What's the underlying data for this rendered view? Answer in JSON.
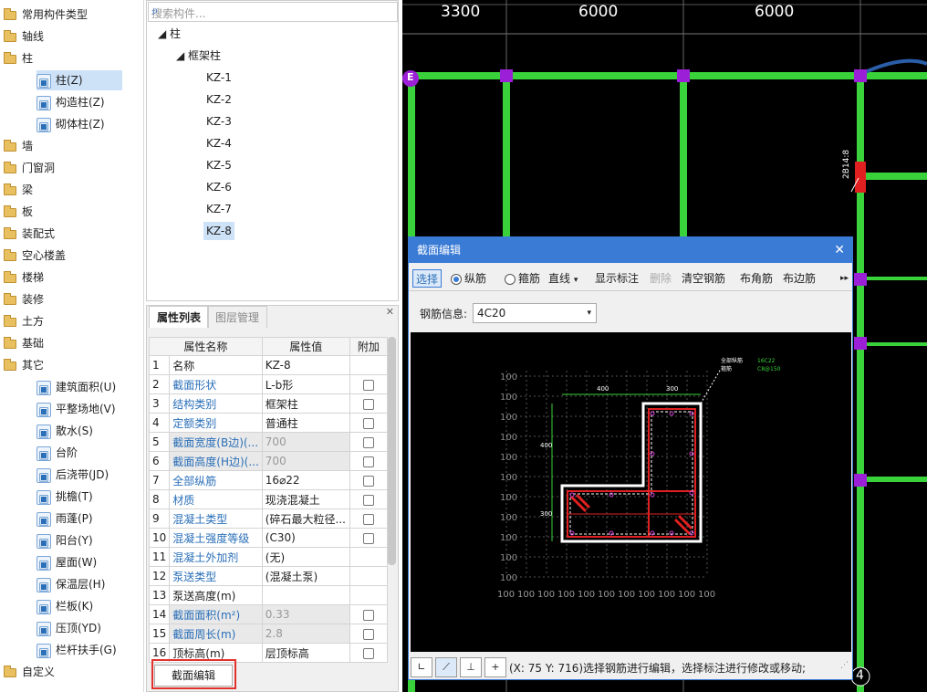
{
  "tree": {
    "items": [
      {
        "label": "常用构件类型",
        "level": 0,
        "icon": "folder-icon"
      },
      {
        "label": "轴线",
        "level": 0,
        "icon": "folder-icon"
      },
      {
        "label": "柱",
        "level": 0,
        "icon": "open-folder-icon"
      },
      {
        "label": "柱(Z)",
        "level": 1,
        "icon": "column-icon",
        "selected": true
      },
      {
        "label": "构造柱(Z)",
        "level": 1,
        "icon": "constructional-column-icon"
      },
      {
        "label": "砌体柱(Z)",
        "level": 1,
        "icon": "masonry-column-icon"
      },
      {
        "label": "墙",
        "level": 0,
        "icon": "folder-icon"
      },
      {
        "label": "门窗洞",
        "level": 0,
        "icon": "folder-icon"
      },
      {
        "label": "梁",
        "level": 0,
        "icon": "folder-icon"
      },
      {
        "label": "板",
        "level": 0,
        "icon": "folder-icon"
      },
      {
        "label": "装配式",
        "level": 0,
        "icon": "folder-icon"
      },
      {
        "label": "空心楼盖",
        "level": 0,
        "icon": "folder-icon"
      },
      {
        "label": "楼梯",
        "level": 0,
        "icon": "folder-icon"
      },
      {
        "label": "装修",
        "level": 0,
        "icon": "folder-icon"
      },
      {
        "label": "土方",
        "level": 0,
        "icon": "folder-icon"
      },
      {
        "label": "基础",
        "level": 0,
        "icon": "folder-icon"
      },
      {
        "label": "其它",
        "level": 0,
        "icon": "open-folder-icon"
      },
      {
        "label": "建筑面积(U)",
        "level": 1,
        "icon": "building-area-icon"
      },
      {
        "label": "平整场地(V)",
        "level": 1,
        "icon": "site-leveling-icon"
      },
      {
        "label": "散水(S)",
        "level": 1,
        "icon": "apron-icon"
      },
      {
        "label": "台阶",
        "level": 1,
        "icon": "steps-icon"
      },
      {
        "label": "后浇带(JD)",
        "level": 1,
        "icon": "post-pour-strip-icon"
      },
      {
        "label": "挑檐(T)",
        "level": 1,
        "icon": "cornice-icon"
      },
      {
        "label": "雨蓬(P)",
        "level": 1,
        "icon": "canopy-icon"
      },
      {
        "label": "阳台(Y)",
        "level": 1,
        "icon": "balcony-icon"
      },
      {
        "label": "屋面(W)",
        "level": 1,
        "icon": "roof-icon"
      },
      {
        "label": "保温层(H)",
        "level": 1,
        "icon": "insulation-icon"
      },
      {
        "label": "栏板(K)",
        "level": 1,
        "icon": "parapet-icon"
      },
      {
        "label": "压顶(YD)",
        "level": 1,
        "icon": "coping-icon"
      },
      {
        "label": "栏杆扶手(G)",
        "level": 1,
        "icon": "railing-icon"
      },
      {
        "label": "自定义",
        "level": 0,
        "icon": "folder-icon"
      }
    ]
  },
  "components": {
    "search_placeholder": "搜索构件...",
    "root": "柱",
    "group": "框架柱",
    "items": [
      "KZ-1",
      "KZ-2",
      "KZ-3",
      "KZ-4",
      "KZ-5",
      "KZ-6",
      "KZ-7",
      "KZ-8"
    ],
    "selected": "KZ-8"
  },
  "props": {
    "tab_attr": "属性列表",
    "tab_layer": "图层管理",
    "headers": [
      "属性名称",
      "属性值",
      "附加"
    ],
    "rows": [
      {
        "n": "1",
        "name": "名称",
        "value": "KZ-8",
        "blue": false,
        "gray": false,
        "cb": false
      },
      {
        "n": "2",
        "name": "截面形状",
        "value": "L-b形",
        "blue": true,
        "gray": false,
        "cb": true
      },
      {
        "n": "3",
        "name": "结构类别",
        "value": "框架柱",
        "blue": true,
        "gray": false,
        "cb": true
      },
      {
        "n": "4",
        "name": "定额类别",
        "value": "普通柱",
        "blue": true,
        "gray": false,
        "cb": true
      },
      {
        "n": "5",
        "name": "截面宽度(B边)(...",
        "value": "700",
        "blue": true,
        "gray": true,
        "cb": true
      },
      {
        "n": "6",
        "name": "截面高度(H边)(...",
        "value": "700",
        "blue": true,
        "gray": true,
        "cb": true
      },
      {
        "n": "7",
        "name": "全部纵筋",
        "value": "16⌀22",
        "blue": true,
        "gray": false,
        "cb": true
      },
      {
        "n": "8",
        "name": "材质",
        "value": "现浇混凝土",
        "blue": true,
        "gray": false,
        "cb": true
      },
      {
        "n": "9",
        "name": "混凝土类型",
        "value": "(碎石最大粒径...",
        "blue": true,
        "gray": false,
        "cb": true
      },
      {
        "n": "10",
        "name": "混凝土强度等级",
        "value": "(C30)",
        "blue": true,
        "gray": false,
        "cb": true
      },
      {
        "n": "11",
        "name": "混凝土外加剂",
        "value": "(无)",
        "blue": true,
        "gray": false,
        "cb": false
      },
      {
        "n": "12",
        "name": "泵送类型",
        "value": "(混凝土泵)",
        "blue": true,
        "gray": false,
        "cb": false
      },
      {
        "n": "13",
        "name": "泵送高度(m)",
        "value": "",
        "blue": false,
        "gray": false,
        "cb": false
      },
      {
        "n": "14",
        "name": "截面面积(m²)",
        "value": "0.33",
        "blue": true,
        "gray": true,
        "cb": true
      },
      {
        "n": "15",
        "name": "截面周长(m)",
        "value": "2.8",
        "blue": true,
        "gray": true,
        "cb": true
      },
      {
        "n": "16",
        "name": "顶标高(m)",
        "value": "层顶标高",
        "blue": false,
        "gray": false,
        "cb": true
      }
    ],
    "section_edit_button": "截面编辑"
  },
  "cad": {
    "dims": [
      "3300",
      "6000",
      "6000"
    ],
    "axis_e": "E",
    "axis_4": "4",
    "beam_label": "2B14:8"
  },
  "dialog": {
    "title": "截面编辑",
    "toolbar": {
      "select": "选择",
      "longitudinal": "纵筋",
      "stirrup": "箍筋",
      "line_mode": "直线",
      "show_dim": "显示标注",
      "delete": "删除",
      "clear": "清空钢筋",
      "corner": "布角筋",
      "edge": "布边筋"
    },
    "rebar_info_label": "钢筋信息:",
    "rebar_info_value": "4C20",
    "section": {
      "dim_400_top": "400",
      "dim_300_top": "300",
      "dim_400_left": "400",
      "dim_300_left": "300",
      "legend_all": "全部纵筋",
      "legend_stirrup": "箍筋",
      "legend_all_value": "16C22",
      "legend_stirrup_value": "C8@150",
      "grid_label": "100"
    },
    "status_text": "(X: 75 Y: 716)选择钢筋进行编辑，选择标注进行修改或移动;"
  },
  "colors": {
    "accent": "#3a7bd5",
    "beam": "#3ad23a",
    "column": "#9b1fd6",
    "highlight": "#e3312d"
  }
}
